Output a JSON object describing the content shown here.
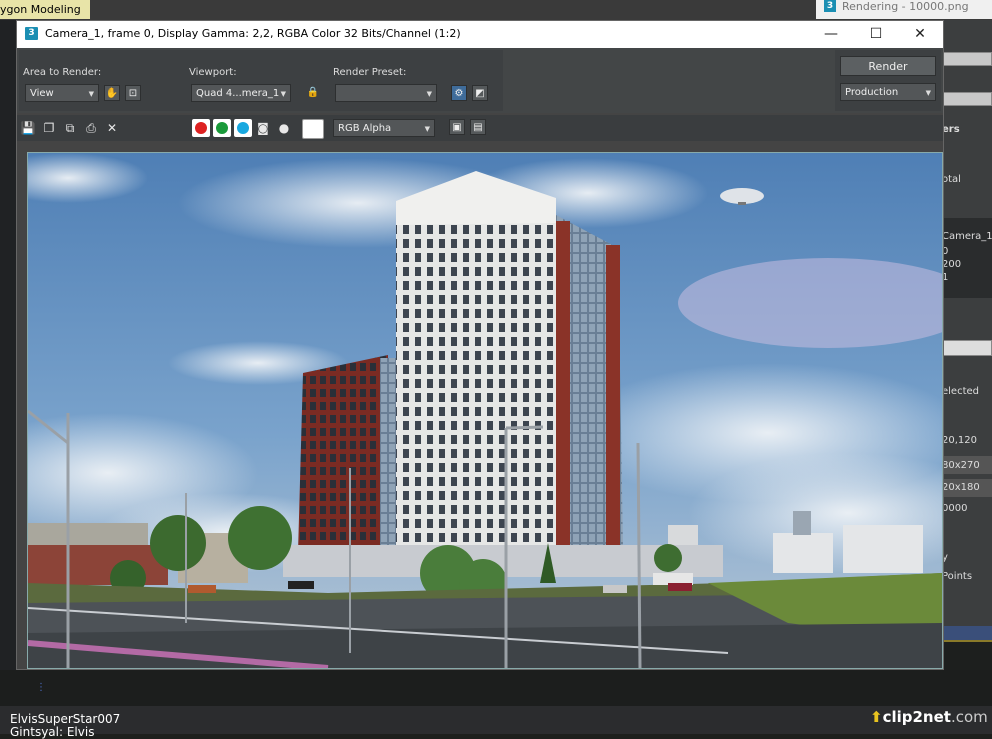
{
  "background_tabs": {
    "polygon_modeling": "ygon Modeling",
    "rendering": "Rendering - 10000.png"
  },
  "window": {
    "title": "Camera_1, frame 0, Display Gamma: 2,2, RGBA Color 32 Bits/Channel (1:2)",
    "app_icon": "3",
    "minimize": "—",
    "maximize": "☐",
    "close": "✕"
  },
  "render_settings": {
    "area_label": "Area to Render:",
    "area_value": "View",
    "viewport_label": "Viewport:",
    "viewport_value": "Quad 4...mera_1",
    "preset_label": "Render Preset:",
    "preset_value": "",
    "render_button": "Render",
    "mode_value": "Production"
  },
  "channel_bar": {
    "channel_display": "RGB Alpha",
    "colors": {
      "red": "#d22",
      "green": "#1a9a3a",
      "blue": "#18a8e0"
    }
  },
  "right_panel": {
    "items": [
      "ers",
      "otal",
      "Camera_1",
      "0",
      "200",
      "1",
      "elected",
      "20,120",
      "80x270",
      "20x180",
      "0000",
      "y",
      "Points"
    ]
  },
  "credits": {
    "line1": "ElvisSuperStar007",
    "line2": "Gintsyal: Elvis"
  },
  "watermark": {
    "brand": "clip2net",
    "suffix": ".com"
  }
}
